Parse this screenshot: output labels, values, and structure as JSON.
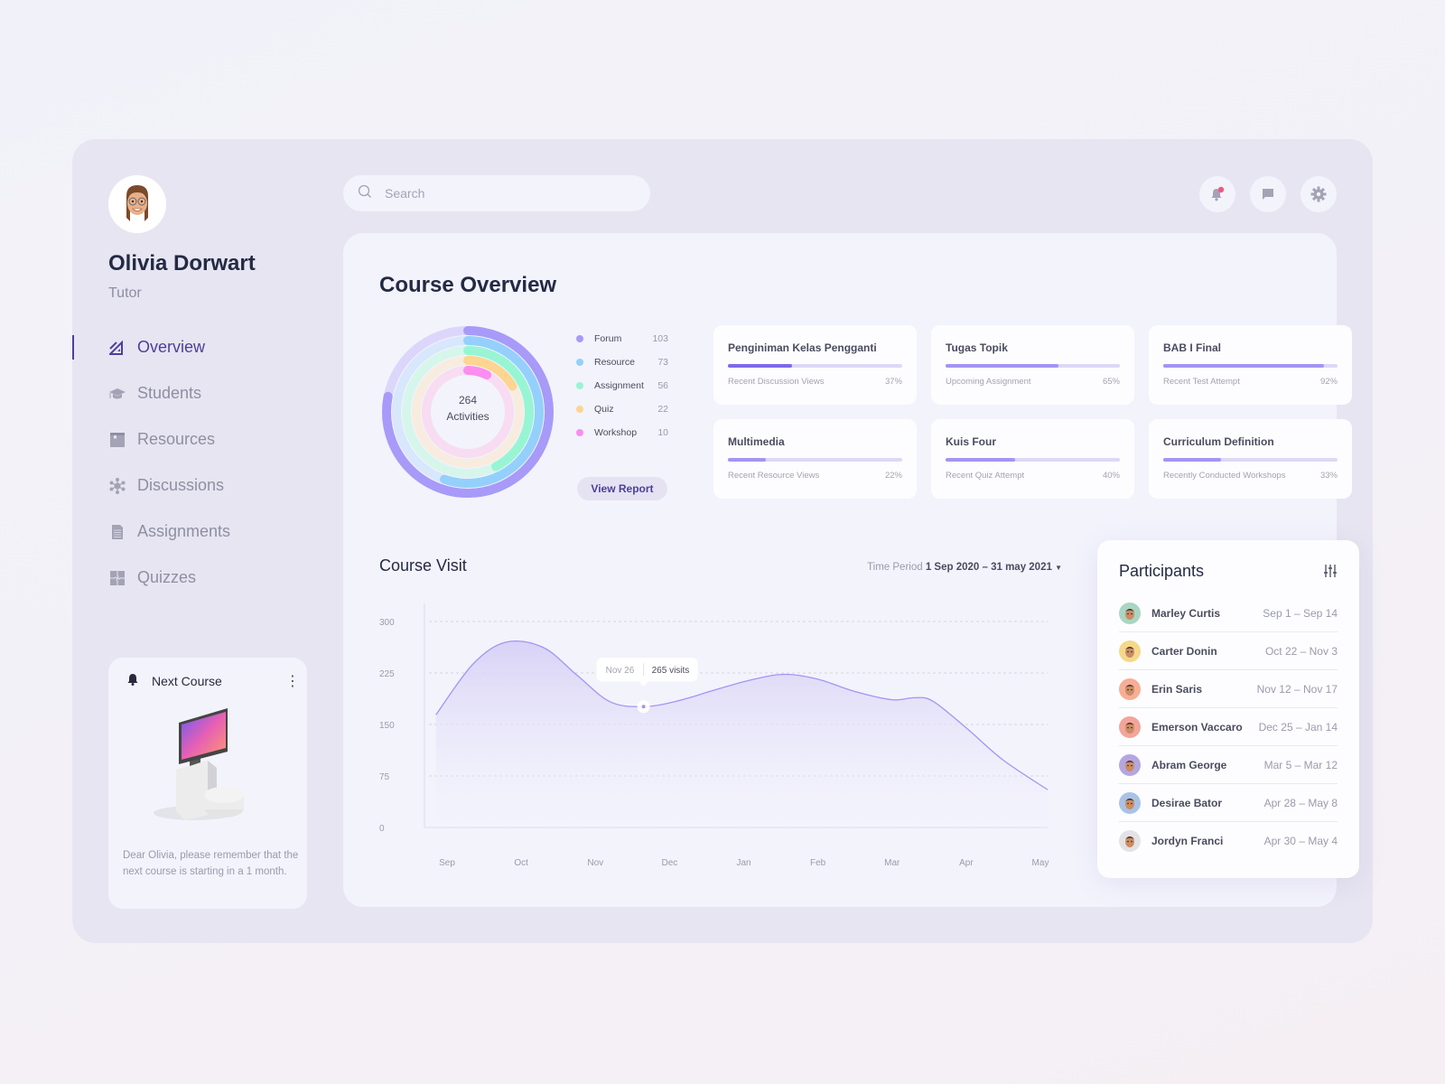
{
  "user": {
    "name": "Olivia Dorwart",
    "role": "Tutor",
    "avatar_icon": "memoji-avatar-icon"
  },
  "nav": {
    "items": [
      {
        "label": "Overview",
        "icon": "overview-icon",
        "active": true
      },
      {
        "label": "Students",
        "icon": "graduation-cap-icon",
        "active": false
      },
      {
        "label": "Resources",
        "icon": "book-icon",
        "active": false
      },
      {
        "label": "Discussions",
        "icon": "network-icon",
        "active": false
      },
      {
        "label": "Assignments",
        "icon": "document-icon",
        "active": false
      },
      {
        "label": "Quizzes",
        "icon": "puzzle-icon",
        "active": false
      }
    ]
  },
  "next_course": {
    "title": "Next Course",
    "icon": "bell-icon",
    "menu_icon": "kebab-menu-icon",
    "message": "Dear Olivia, please remember that the next course is starting in a 1 month."
  },
  "search": {
    "placeholder": "Search",
    "value": ""
  },
  "topbar": {
    "notification_icon": "bell-icon",
    "notification_badge_color": "#f5577b",
    "messages_icon": "chat-icon",
    "settings_icon": "gear-icon"
  },
  "overview": {
    "title": "Course Overview",
    "total": "264",
    "total_label": "Activities",
    "view_report_label": "View Report",
    "activities": [
      {
        "name": "Forum",
        "value": 103,
        "color": "#a89af8"
      },
      {
        "name": "Resource",
        "value": 73,
        "color": "#94d0fb"
      },
      {
        "name": "Assignment",
        "value": 56,
        "color": "#98f5d4"
      },
      {
        "name": "Quiz",
        "value": 22,
        "color": "#fdd592"
      },
      {
        "name": "Workshop",
        "value": 10,
        "color": "#fb8df0"
      }
    ],
    "cards": [
      {
        "title": "Penginiman Kelas Pengganti",
        "label": "Recent Discussion Views",
        "percent": 37,
        "percent_text": "37%"
      },
      {
        "title": "Tugas Topik",
        "label": "Upcoming Assignment",
        "percent": 65,
        "percent_text": "65%"
      },
      {
        "title": "BAB I Final",
        "label": "Recent Test Attempt",
        "percent": 92,
        "percent_text": "92%"
      },
      {
        "title": "Multimedia",
        "label": "Recent Resource Views",
        "percent": 22,
        "percent_text": "22%"
      },
      {
        "title": "Kuis Four",
        "label": "Recent Quiz Attempt",
        "percent": 40,
        "percent_text": "40%"
      },
      {
        "title": "Curriculum Definition",
        "label": "Recently Conducted Workshops",
        "percent": 33,
        "percent_text": "33%"
      }
    ]
  },
  "course_visit": {
    "title": "Course Visit",
    "period_label": "Time Period",
    "period_value": "1 Sep 2020 – 31 may 2021",
    "tooltip": {
      "date": "Nov 26",
      "value": "265 visits"
    }
  },
  "chart_data": {
    "type": "area",
    "title": "Course Visit",
    "xlabel": "",
    "ylabel": "",
    "categories": [
      "Sep",
      "Oct",
      "Nov",
      "Dec",
      "Jan",
      "Feb",
      "Mar",
      "Apr",
      "May"
    ],
    "yticks": [
      0,
      75,
      150,
      225,
      300
    ],
    "ylim": [
      0,
      300
    ],
    "grid": true,
    "series": [
      {
        "name": "Visits",
        "color": "#a594f3",
        "x": [
          -0.15,
          0.35,
          0.8,
          1.3,
          1.75,
          2.2,
          2.65,
          3.1,
          3.6,
          4.1,
          4.55,
          5.0,
          5.5,
          6.0,
          6.3,
          6.55,
          7.0,
          7.5,
          8.1
        ],
        "values": [
          164,
          238,
          270,
          262,
          222,
          183,
          176,
          184,
          200,
          215,
          223,
          216,
          198,
          186,
          189,
          184,
          145,
          98,
          55
        ]
      }
    ],
    "highlight": {
      "x": 2.65,
      "value": 176,
      "label_date": "Nov 26",
      "label_value": "265 visits"
    }
  },
  "participants": {
    "title": "Participants",
    "filter_icon": "sliders-icon",
    "rows": [
      {
        "name": "Marley Curtis",
        "dates": "Sep 1 – Sep 14",
        "avatar_color": "#a9d6c3"
      },
      {
        "name": "Carter Donin",
        "dates": "Oct 22 – Nov 3",
        "avatar_color": "#f5d98a"
      },
      {
        "name": "Erin Saris",
        "dates": "Nov 12 – Nov 17",
        "avatar_color": "#f8ad95"
      },
      {
        "name": "Emerson Vaccaro",
        "dates": "Dec 25 – Jan 14",
        "avatar_color": "#f3a59a"
      },
      {
        "name": "Abram George",
        "dates": "Mar 5 – Mar 12",
        "avatar_color": "#b5a6e0"
      },
      {
        "name": "Desirae Bator",
        "dates": "Apr 28 – May 8",
        "avatar_color": "#a9c3e6"
      },
      {
        "name": "Jordyn Franci",
        "dates": "Apr 30 – May 4",
        "avatar_color": "#e3e3e6"
      }
    ]
  }
}
